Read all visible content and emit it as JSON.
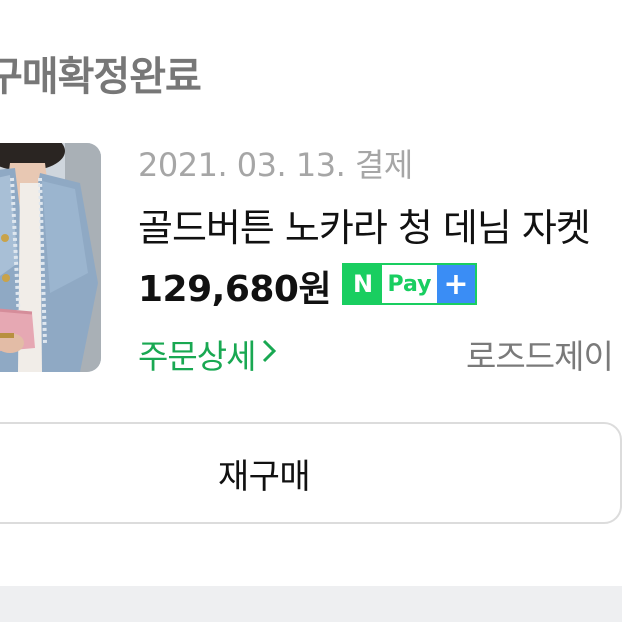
{
  "order": {
    "status": "구매확정완료",
    "date": "2021. 03. 13. 결제",
    "product_name": "골드버튼 노카라 청 데님 자켓",
    "price": "129,680원",
    "npay": {
      "n": "N",
      "pay": "Pay",
      "plus": "+"
    },
    "detail_link": "주문상세",
    "seller": "로즈드제이",
    "rebuy_button": "재구매"
  },
  "colors": {
    "accent_green": "#19ce60",
    "link_green": "#19a852",
    "npay_plus_blue": "#3a8df5"
  }
}
